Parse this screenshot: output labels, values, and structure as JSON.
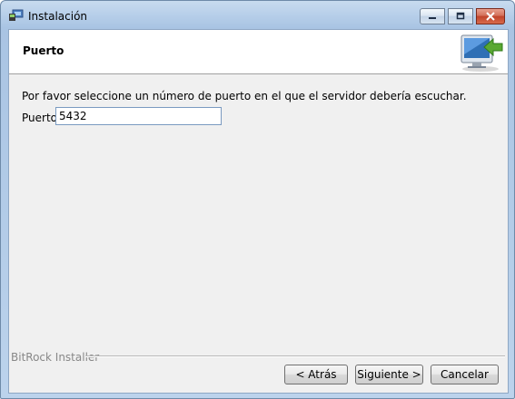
{
  "window": {
    "title": "Instalación",
    "controls": {
      "minimize": "minimize",
      "maximize": "maximize",
      "close": "close"
    }
  },
  "header": {
    "title": "Puerto",
    "icon": "installer-computer-arrow-icon"
  },
  "body": {
    "prompt": "Por favor seleccione un número de puerto en el que el servidor debería escuchar.",
    "port_label": "Puerto",
    "port_value": "5432"
  },
  "footer": {
    "brand": "BitRock Installer",
    "back_label": "< Atrás",
    "next_label": "Siguiente >",
    "cancel_label": "Cancelar"
  },
  "colors": {
    "titlebar": "#b9d0ea",
    "client_bg": "#f0f0f0",
    "header_bg": "#ffffff",
    "close_button": "#c0432a",
    "accent_arrow": "#5aa832"
  }
}
